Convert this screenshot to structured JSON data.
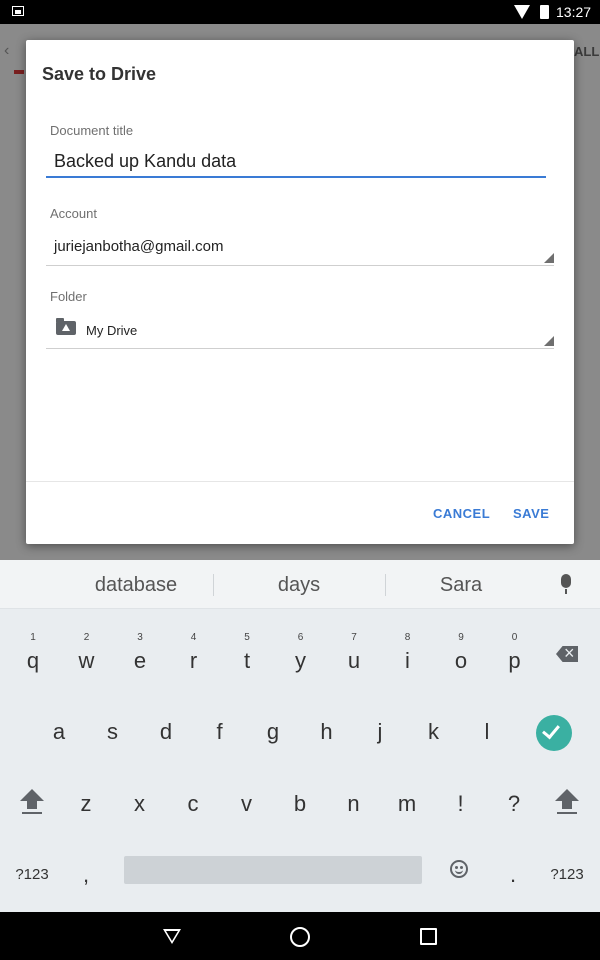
{
  "status_bar": {
    "time": "13:27"
  },
  "backdrop": {
    "partial_action": "ALL"
  },
  "dialog": {
    "title": "Save to Drive",
    "document_title_label": "Document title",
    "document_title_value": "Backed up Kandu data",
    "account_label": "Account",
    "account_value": "juriejanbotha@gmail.com",
    "folder_label": "Folder",
    "folder_value": "My Drive",
    "cancel_label": "CANCEL",
    "save_label": "SAVE"
  },
  "keyboard": {
    "suggestions": [
      "database",
      "days",
      "Sara"
    ],
    "row1": [
      {
        "ch": "q",
        "hint": "1"
      },
      {
        "ch": "w",
        "hint": "2"
      },
      {
        "ch": "e",
        "hint": "3"
      },
      {
        "ch": "r",
        "hint": "4"
      },
      {
        "ch": "t",
        "hint": "5"
      },
      {
        "ch": "y",
        "hint": "6"
      },
      {
        "ch": "u",
        "hint": "7"
      },
      {
        "ch": "i",
        "hint": "8"
      },
      {
        "ch": "o",
        "hint": "9"
      },
      {
        "ch": "p",
        "hint": "0"
      }
    ],
    "row2": [
      "a",
      "s",
      "d",
      "f",
      "g",
      "h",
      "j",
      "k",
      "l"
    ],
    "row3": [
      "z",
      "x",
      "c",
      "v",
      "b",
      "n",
      "m",
      "!",
      "?"
    ],
    "row4": {
      "symbols_left": "?123",
      "comma": ",",
      "period": ".",
      "symbols_right": "?123"
    },
    "icons": {
      "mic": "microphone-icon",
      "backspace": "backspace-icon",
      "enter": "checkmark-icon",
      "shift": "shift-icon",
      "emoji": "smiley-icon"
    },
    "accent_color": "#3ab0a2"
  },
  "nav_bar": {
    "icons": [
      "back-icon",
      "home-icon",
      "recents-icon"
    ]
  }
}
